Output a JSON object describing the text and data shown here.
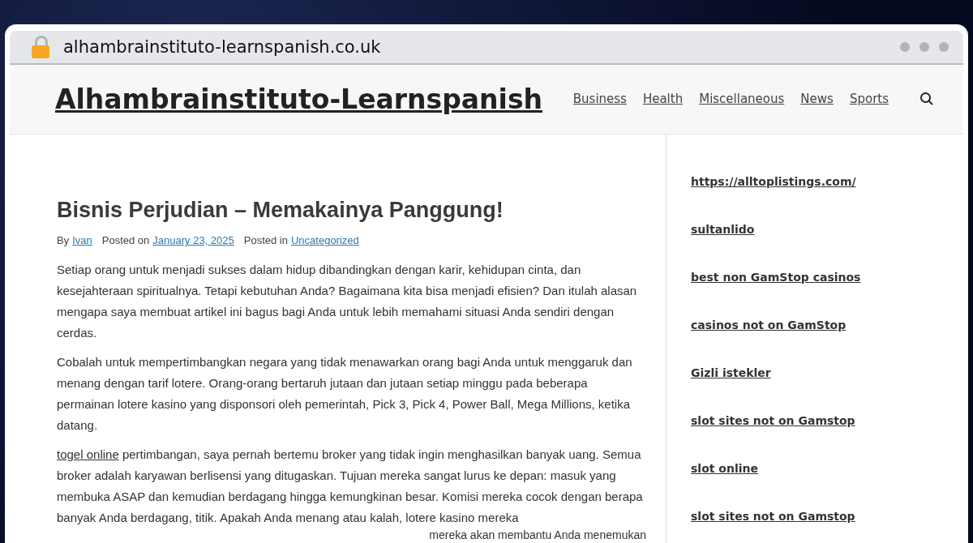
{
  "browser": {
    "url": "alhambrainstituto-learnspanish.co.uk"
  },
  "site": {
    "title": "Alhambrainstituto-Learnspanish",
    "nav": [
      {
        "label": "Business"
      },
      {
        "label": "Health"
      },
      {
        "label": "Miscellaneous"
      },
      {
        "label": "News"
      },
      {
        "label": "Sports"
      }
    ]
  },
  "article": {
    "title": "Bisnis Perjudian – Memakainya Panggung!",
    "meta": {
      "by_label": "By",
      "author": "Ivan",
      "posted_on_label": "Posted on",
      "date": "January 23, 2025",
      "posted_in_label": "Posted in",
      "category": "Uncategorized"
    },
    "paragraphs": [
      {
        "text": "Setiap orang untuk menjadi sukses dalam hidup dibandingkan dengan karir, kehidupan cinta, dan kesejahteraan spiritualnya. Tetapi kebutuhan Anda? Bagaimana kita bisa menjadi efisien? Dan itulah alasan mengapa saya membuat artikel ini bagus bagi Anda untuk lebih memahami situasi Anda sendiri dengan cerdas."
      },
      {
        "text": "Cobalah untuk mempertimbangkan negara yang tidak menawarkan orang bagi Anda untuk menggaruk dan menang dengan tarif lotere. Orang-orang bertaruh jutaan dan jutaan setiap minggu pada beberapa permainan lotere kasino yang disponsori oleh pemerintah, Pick 3, Pick 4, Power Ball, Mega Millions, ketika datang."
      },
      {
        "link": "togel online",
        "text": "pertimbangan, saya pernah bertemu broker yang tidak ingin menghasilkan banyak uang. Semua broker adalah karyawan berlisensi yang ditugaskan. Tujuan mereka sangat lurus ke depan: masuk yang membuka ASAP dan kemudian berdagang hingga kemungkinan besar. Komisi mereka cocok dengan berapa banyak Anda berdagang, titik. Apakah Anda menang atau kalah, lotere kasino mereka",
        "tail": "mereka akan membantu Anda menemukan"
      }
    ]
  },
  "sidebar": {
    "links": [
      {
        "label": "https://alltoplistings.com/"
      },
      {
        "label": "sultanlido"
      },
      {
        "label": "best non GamStop casinos"
      },
      {
        "label": "casinos not on GamStop"
      },
      {
        "label": "Gizli istekler"
      },
      {
        "label": "slot sites not on Gamstop"
      },
      {
        "label": "slot online"
      },
      {
        "label": "slot sites not on Gamstop"
      }
    ]
  }
}
